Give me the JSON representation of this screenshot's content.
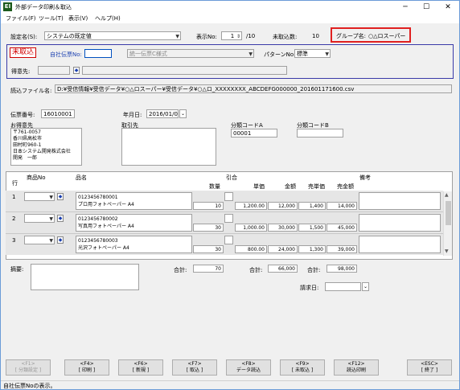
{
  "window": {
    "title": "外部データ印刷＆取込",
    "icon_text": "EI",
    "minimize": "─",
    "maximize": "☐",
    "close": "✕"
  },
  "menu": [
    "ファイル(F)",
    "ツール(T)",
    "表示(V)",
    "ヘルプ(H)"
  ],
  "header": {
    "settings_label": "設定名(S):",
    "settings_value": "システムの既定値",
    "display_no_label": "表示No:",
    "display_no_value": "1",
    "display_total": "/10",
    "unimported_label": "未取込数:",
    "unimported_value": "10",
    "group_label": "グループ名:",
    "group_value": "○△ロスーパー"
  },
  "status_box": {
    "status": "未取込",
    "slip_no_label": "自社伝票No:",
    "slip_no_value": "",
    "form_value": "統一伝票C様式",
    "pattern_label": "パターンNo:",
    "pattern_value": "標準",
    "client_label": "得意先:"
  },
  "file": {
    "label": "読込ファイル名:",
    "value": "D:¥受信情報¥受信データ¥○△ロスーパー¥受信データ¥○△ロ_XXXXXXXX_ABCDEFG000000_201601171600.csv"
  },
  "slip": {
    "slip_number_label": "伝票番号:",
    "slip_number_value": "16010001",
    "date_label": "年月日:",
    "date_value": "2016/01/07",
    "customer_label": "お得意先",
    "customer_lines": [
      "〒761-0057",
      "香川県高松市",
      "田村町960-1",
      "日本システム開発株式会社",
      "開発　一郎"
    ],
    "trade_dest_label": "取引先",
    "code_a_label": "分類コードA",
    "code_a_value": "00001",
    "code_b_label": "分類コードB",
    "code_b_value": ""
  },
  "grid": {
    "headers": {
      "row": "行",
      "product_no": "商品No",
      "name": "品名",
      "discount": "引合",
      "qty": "数量",
      "unit_price": "単価",
      "amount": "金額",
      "sell_unit": "売単価",
      "sell_amount": "売金額",
      "note": "備考"
    },
    "rows": [
      {
        "row": "1",
        "code": "0123456780001",
        "name": "プロ用フォトペーパー A4",
        "qty": "10",
        "unit_price": "1,200.00",
        "amount": "12,000",
        "sell_unit": "1,400",
        "sell_amount": "14,000"
      },
      {
        "row": "2",
        "code": "0123456780002",
        "name": "写真用フォトペーパー A4",
        "qty": "30",
        "unit_price": "1,000.00",
        "amount": "30,000",
        "sell_unit": "1,500",
        "sell_amount": "45,000"
      },
      {
        "row": "3",
        "code": "0123456780003",
        "name": "光沢フォトペーパー A4",
        "qty": "30",
        "unit_price": "800.00",
        "amount": "24,000",
        "sell_unit": "1,300",
        "sell_amount": "39,000"
      }
    ]
  },
  "footer": {
    "memo_label": "摘要:",
    "total_qty_label": "合計:",
    "total_qty_value": "70",
    "total_amount_label": "合計:",
    "total_amount_value": "66,000",
    "total_sell_label": "合計:",
    "total_sell_value": "98,000",
    "billing_date_label": "請求日:",
    "billing_date_value": ""
  },
  "fkeys": [
    {
      "key": "<F1>",
      "label": "[ 分類設定 ]",
      "enabled": false
    },
    {
      "key": "<F4>",
      "label": "[ 印刷 ]",
      "enabled": true
    },
    {
      "key": "<F6>",
      "label": "[ 新規 ]",
      "enabled": true
    },
    {
      "key": "<F7>",
      "label": "[ 取込 ]",
      "enabled": true
    },
    {
      "key": "<F8>",
      "label": "データ読込",
      "enabled": true
    },
    {
      "key": "<F9>",
      "label": "[ 未取込 ]",
      "enabled": true
    },
    {
      "key": "<F12>",
      "label": "読込印刷",
      "enabled": true
    },
    {
      "key": "<ESC>",
      "label": "[ 終了 ]",
      "enabled": true
    }
  ],
  "status_bar": "自社伝票Noの表示。",
  "colors": {
    "group_border": "#e02020",
    "status_red": "#d00000",
    "panel_border": "#3a3aa8",
    "label_blue": "#1a3fb0"
  }
}
